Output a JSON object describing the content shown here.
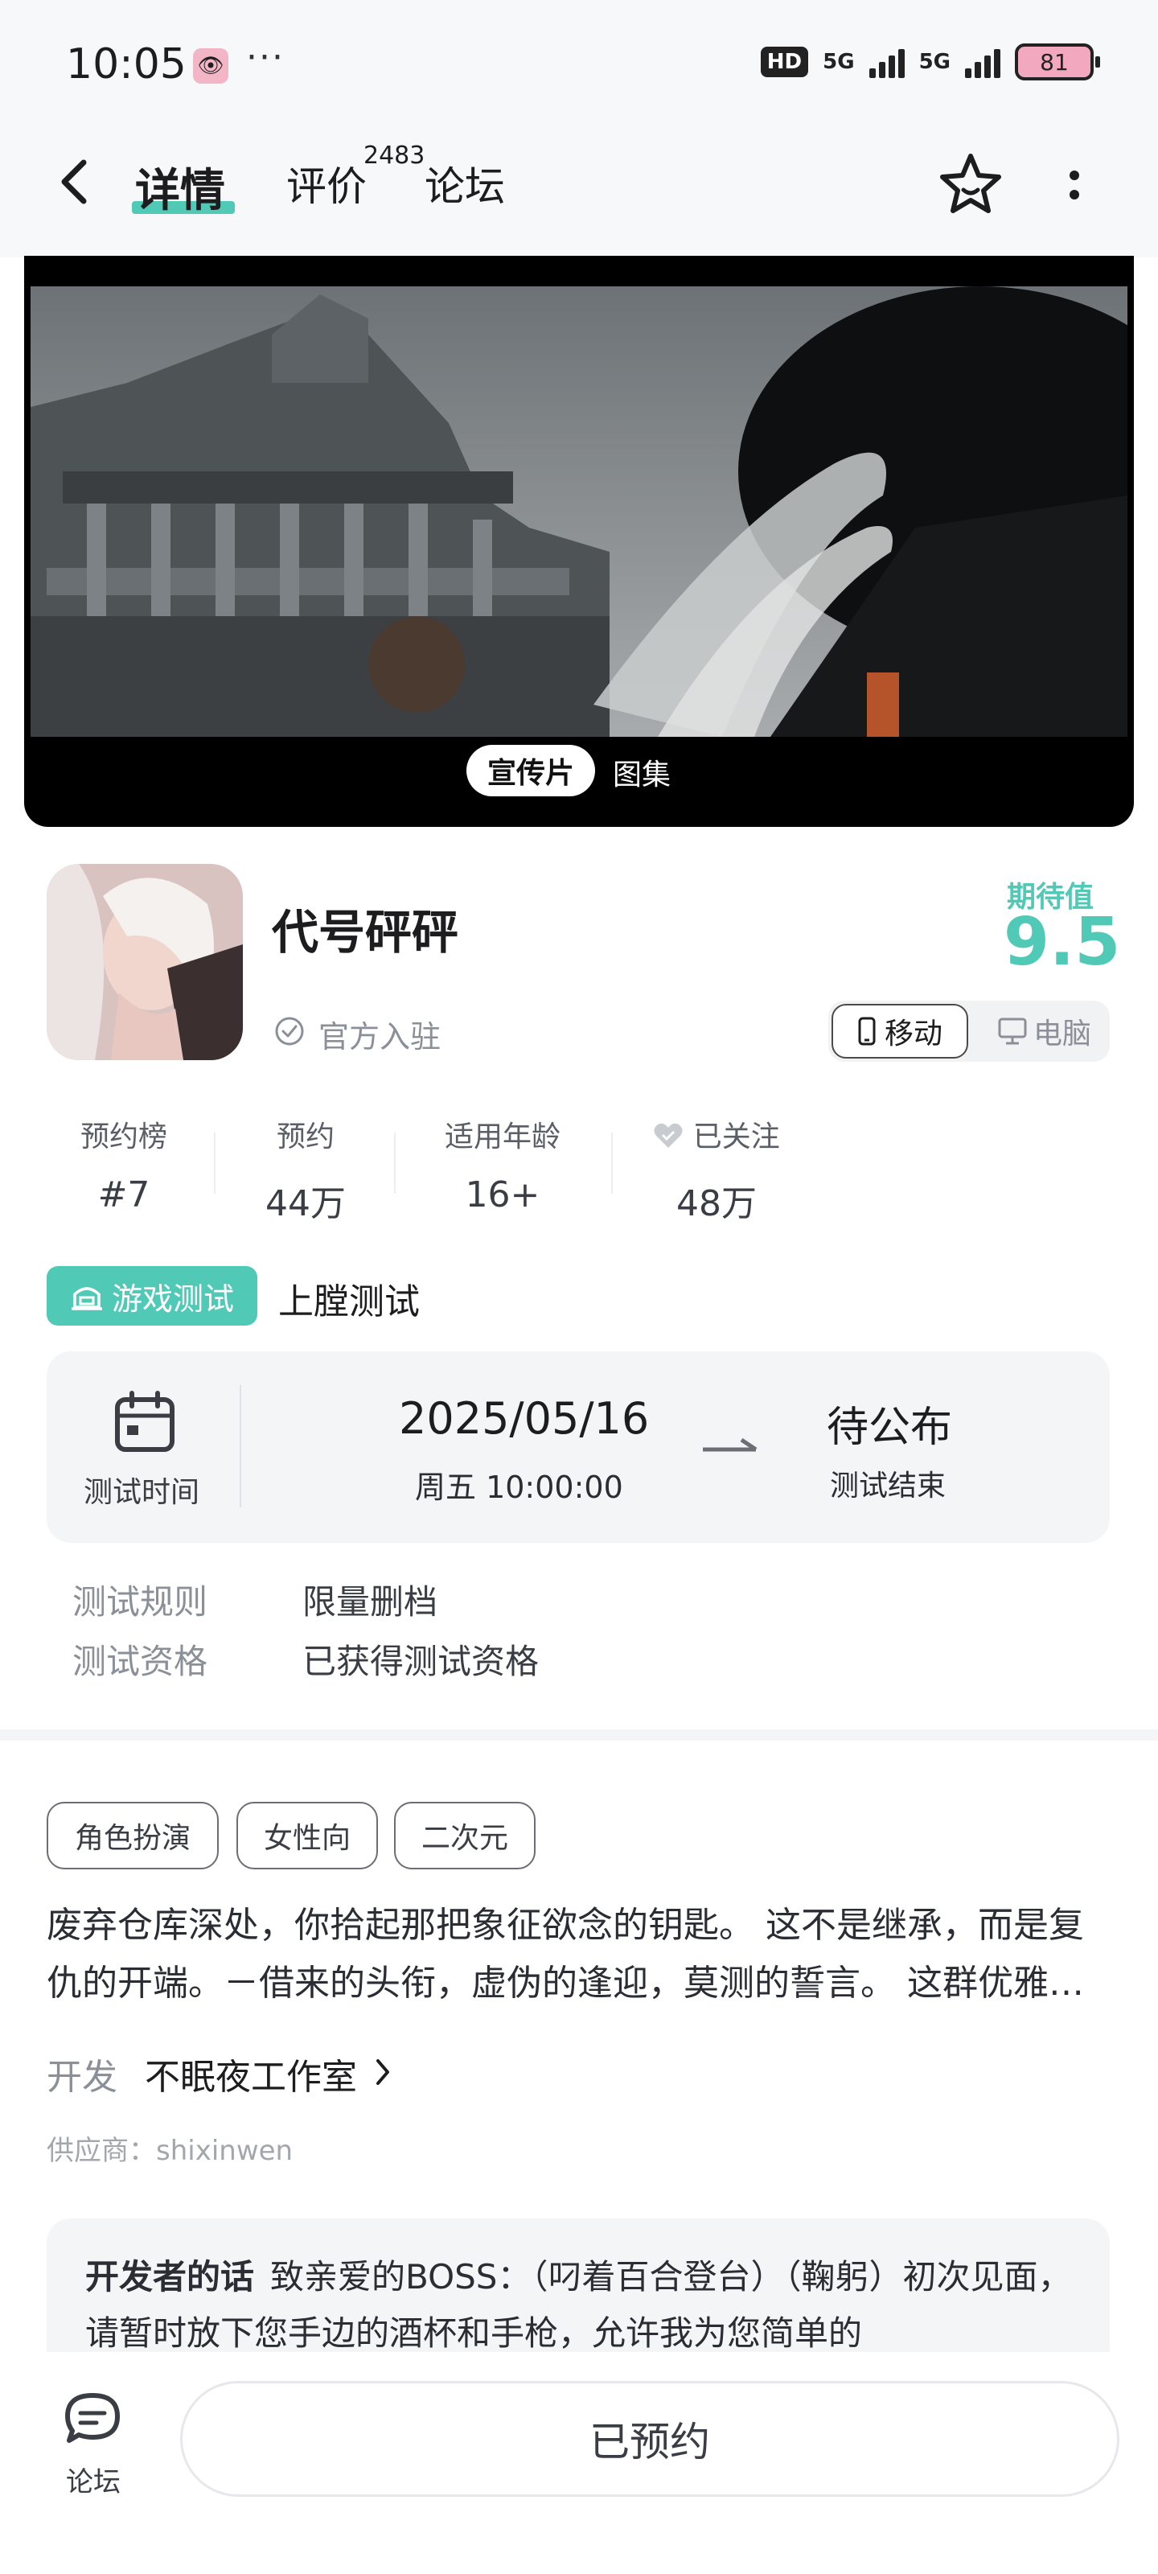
{
  "status_bar": {
    "time": "10:05",
    "dots": "···",
    "hd_badge": "HD",
    "network_1": "5G",
    "network_2": "5G",
    "battery": "81"
  },
  "nav": {
    "tabs": [
      {
        "label": "详情",
        "active": true
      },
      {
        "label": "评价",
        "count": "2483"
      },
      {
        "label": "论坛"
      }
    ]
  },
  "banner": {
    "tabs": [
      {
        "label": "宣传片",
        "active": true
      },
      {
        "label": "图集"
      }
    ]
  },
  "game": {
    "title": "代号砰砰",
    "verified_label": "官方入驻",
    "expect_label": "期待值",
    "expect_value": "9.5",
    "platforms": [
      {
        "label": "移动",
        "selected": true,
        "icon": "phone-icon"
      },
      {
        "label": "电脑",
        "selected": false,
        "icon": "monitor-icon"
      }
    ]
  },
  "stats": [
    {
      "label": "预约榜",
      "value": "#7"
    },
    {
      "label": "预约",
      "value": "44万"
    },
    {
      "label": "适用年龄",
      "value": "16+"
    },
    {
      "label": "已关注",
      "value": "48万",
      "icon": "heart-icon"
    }
  ],
  "test": {
    "chip_label": "游戏测试",
    "type": "上膛测试",
    "time_label": "测试时间",
    "start_date": "2025/05/16",
    "start_time": "周五  10:00:00",
    "end_value": "待公布",
    "end_label": "测试结束",
    "rules": [
      {
        "label": "测试规则",
        "value": "限量删档"
      },
      {
        "label": "测试资格",
        "value": "已获得测试资格"
      }
    ]
  },
  "tags": [
    "角色扮演",
    "女性向",
    "二次元"
  ],
  "description": "废弃仓库深处，你拾起那把象征欲念的钥匙。 这不是继承，而是复仇的开端。－借来的头衔，虚伪的逢迎，莫测的誓言。 这群优雅…",
  "developer": {
    "label": "开发",
    "name": "不眠夜工作室"
  },
  "supplier": "供应商：shixinwen",
  "dev_words": {
    "title": "开发者的话",
    "text": "致亲爱的BOSS：（叼着百合登台）（鞠躬）初次见面，请暂时放下您手边的酒杯和手枪，允许我为您简单的"
  },
  "bottom": {
    "forum_label": "论坛",
    "reserve_label": "已预约"
  },
  "colors": {
    "accent": "#50c9b6",
    "text": "#1d1d1f",
    "muted": "#8a8f98"
  }
}
